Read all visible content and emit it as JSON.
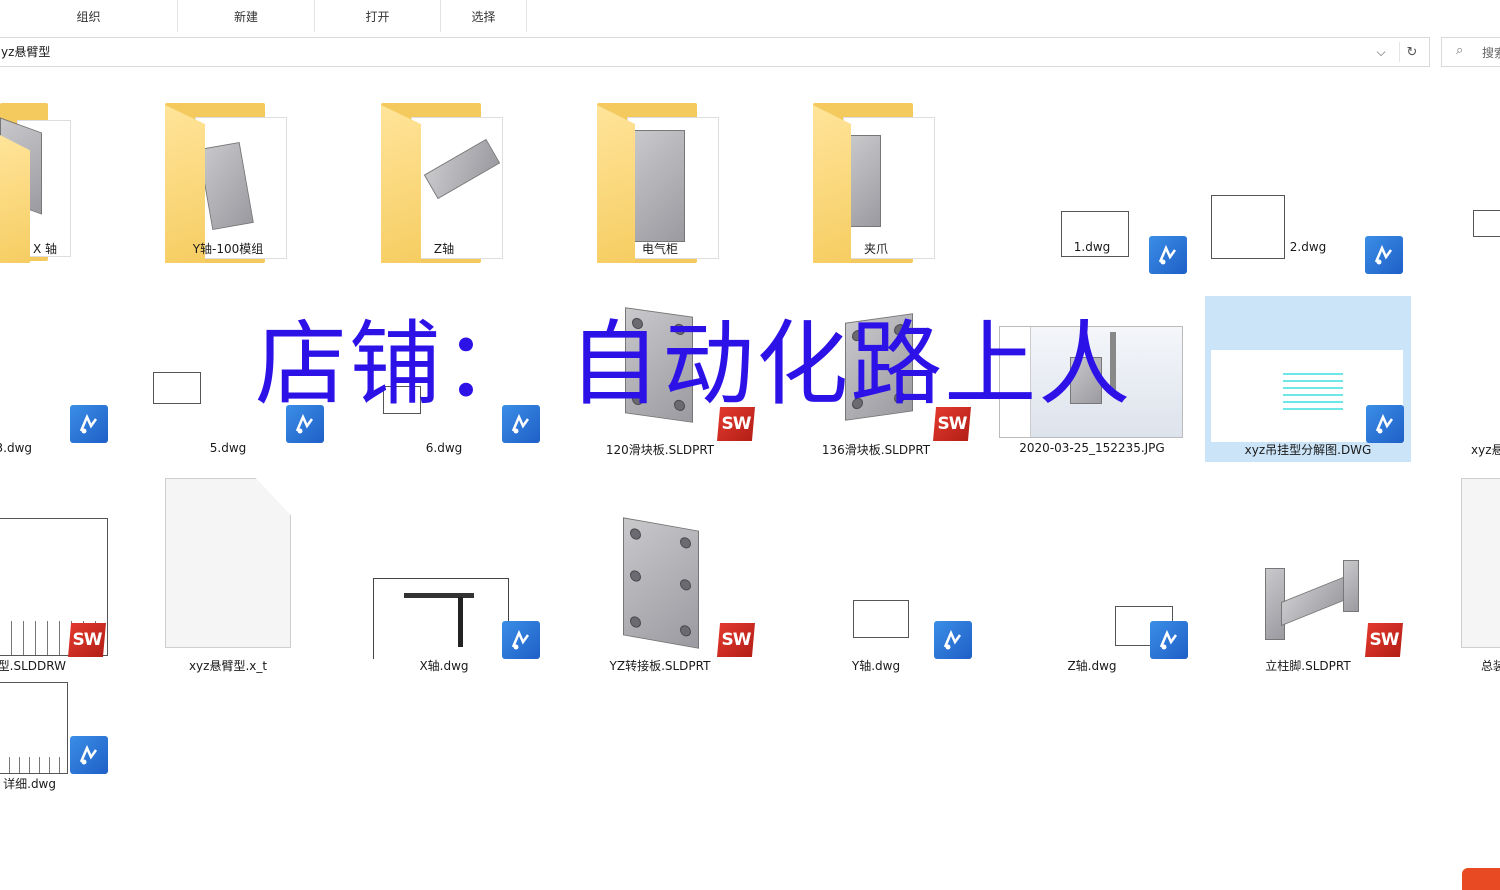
{
  "ribbon": {
    "groups": [
      "组织",
      "新建",
      "打开",
      "选择"
    ]
  },
  "address": {
    "path": "yz悬臂型",
    "search_placeholder": "搜索"
  },
  "watermark": "店铺： 自动化路上人",
  "files": [
    {
      "name": "X 轴",
      "type": "folder"
    },
    {
      "name": "Y轴-100模组",
      "type": "folder"
    },
    {
      "name": "Z轴",
      "type": "folder"
    },
    {
      "name": "电气柜",
      "type": "folder"
    },
    {
      "name": "夹爪",
      "type": "folder"
    },
    {
      "name": "1.dwg",
      "type": "dwg"
    },
    {
      "name": "2.dwg",
      "type": "dwg"
    },
    {
      "name": "3.dwg",
      "type": "dwg"
    },
    {
      "name": "5.dwg",
      "type": "dwg"
    },
    {
      "name": "6.dwg",
      "type": "dwg"
    },
    {
      "name": "120滑块板.SLDPRT",
      "type": "sldprt"
    },
    {
      "name": "136滑块板.SLDPRT",
      "type": "sldprt"
    },
    {
      "name": "2020-03-25_152235.JPG",
      "type": "jpg"
    },
    {
      "name": "xyz吊挂型分解图.DWG",
      "type": "dwg",
      "selected": true
    },
    {
      "name": "xyz悬",
      "type": "dwg"
    },
    {
      "name": "型.SLDDRW",
      "type": "slddrw"
    },
    {
      "name": "xyz悬臂型.x_t",
      "type": "x_t"
    },
    {
      "name": "X轴.dwg",
      "type": "dwg"
    },
    {
      "name": "YZ转接板.SLDPRT",
      "type": "sldprt"
    },
    {
      "name": "Y轴.dwg",
      "type": "dwg"
    },
    {
      "name": "Z轴.dwg",
      "type": "dwg"
    },
    {
      "name": "立柱脚.SLDPRT",
      "type": "sldprt"
    },
    {
      "name": "总装",
      "type": "other"
    },
    {
      "name": "详细.dwg",
      "type": "dwg"
    }
  ],
  "labels": {
    "sw_badge": "SW"
  },
  "colors": {
    "selection": "#cce4f7",
    "watermark": "#2d12e8",
    "dwg_badge": "#2a76d6",
    "sw_badge": "#d42c22",
    "folder": "#f4c95d"
  }
}
